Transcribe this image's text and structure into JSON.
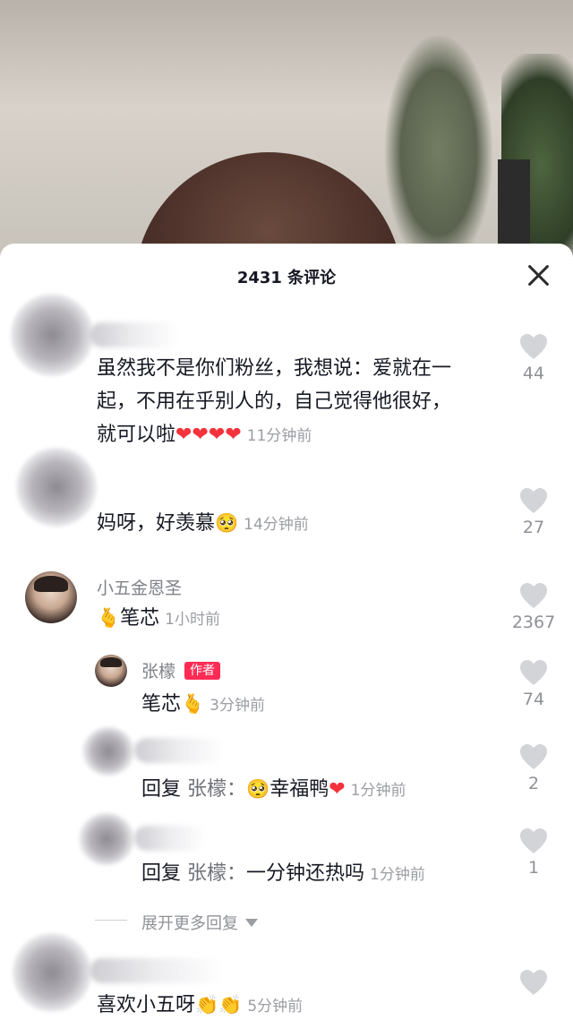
{
  "header": {
    "title": "2431 条评论"
  },
  "comments": [
    {
      "text_lines": [
        "虽然我不是你们粉丝，我想说：爱就在一",
        "起，不用在乎别人的，自己觉得他很好，",
        "就可以啦"
      ],
      "emoji": "❤❤❤❤",
      "time": "11分钟前",
      "likes": "44"
    },
    {
      "text": "妈呀，好羡慕",
      "emoji": "🥺",
      "time": "14分钟前",
      "likes": "27"
    },
    {
      "username": "小五金恩圣",
      "emoji": "🫰",
      "text": "笔芯",
      "time": "1小时前",
      "likes": "2367"
    }
  ],
  "replies": [
    {
      "username": "张檬",
      "badge": "作者",
      "text": "笔芯",
      "emoji": "🫰",
      "time": "3分钟前",
      "likes": "74"
    },
    {
      "prefix": "回复",
      "reply_to": "张檬：",
      "emoji": "🥺",
      "text": "幸福鸭",
      "emoji2": "❤",
      "time": "1分钟前",
      "likes": "2"
    },
    {
      "prefix": "回复",
      "reply_to": "张檬：",
      "text": "一分钟还热吗",
      "time": "1分钟前",
      "likes": "1"
    }
  ],
  "expand": {
    "label": "展开更多回复"
  },
  "last_comment": {
    "text": "喜欢小五呀",
    "emoji": "👏👏",
    "time": "5分钟前"
  }
}
